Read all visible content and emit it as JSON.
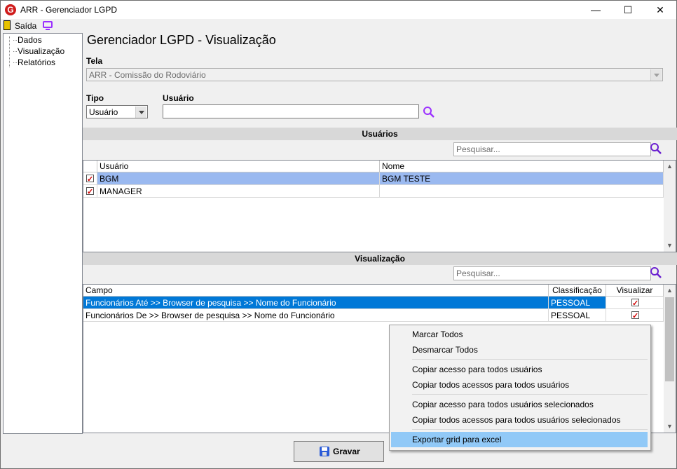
{
  "window": {
    "title": "ARR - Gerenciador LGPD",
    "logo_letter": "G",
    "minimize": "—",
    "maximize": "☐",
    "close": "✕"
  },
  "menu": {
    "exit_label": "Saída"
  },
  "tree": {
    "items": [
      {
        "label": "Dados"
      },
      {
        "label": "Visualização"
      },
      {
        "label": "Relatórios"
      }
    ]
  },
  "page": {
    "title": "Gerenciador LGPD - Visualização",
    "tela_label": "Tela",
    "tela_value": "ARR - Comissão do Rodoviário",
    "tipo_label": "Tipo",
    "tipo_value": "Usuário",
    "usuario_label": "Usuário",
    "usuario_value": ""
  },
  "users_section": {
    "header": "Usuários",
    "search_placeholder": "Pesquisar...",
    "columns": [
      "Usuário",
      "Nome"
    ],
    "rows": [
      {
        "user": "BGM",
        "name": "BGM TESTE",
        "checked": true,
        "selected": true
      },
      {
        "user": "MANAGER",
        "name": "",
        "checked": true,
        "selected": false
      }
    ]
  },
  "view_section": {
    "header": "Visualização",
    "search_placeholder": "Pesquisar...",
    "columns": [
      "Campo",
      "Classificação",
      "Visualizar"
    ],
    "rows": [
      {
        "campo": "Funcionários Até >> Browser de pesquisa >> Nome do Funcionário",
        "classificacao": "PESSOAL",
        "visualizar": true,
        "selected": true
      },
      {
        "campo": "Funcionários De >> Browser de pesquisa >> Nome do Funcionário",
        "classificacao": "PESSOAL",
        "visualizar": true,
        "selected": false
      }
    ]
  },
  "context_menu": {
    "items": [
      "Marcar Todos",
      "Desmarcar Todos",
      "Copiar acesso para todos usuários",
      "Copiar todos acessos para todos usuários",
      "Copiar acesso para todos usuários selecionados",
      "Copiar todos acessos para todos usuários selecionados",
      "Exportar grid para excel"
    ],
    "highlighted_index": 6
  },
  "footer": {
    "save_label": "Gravar"
  },
  "colors": {
    "selection_user": "#9ab9f0",
    "selection_view": "#0078d7",
    "search_icon": "#9b30ff",
    "menu_highlight": "#91c9f7"
  }
}
